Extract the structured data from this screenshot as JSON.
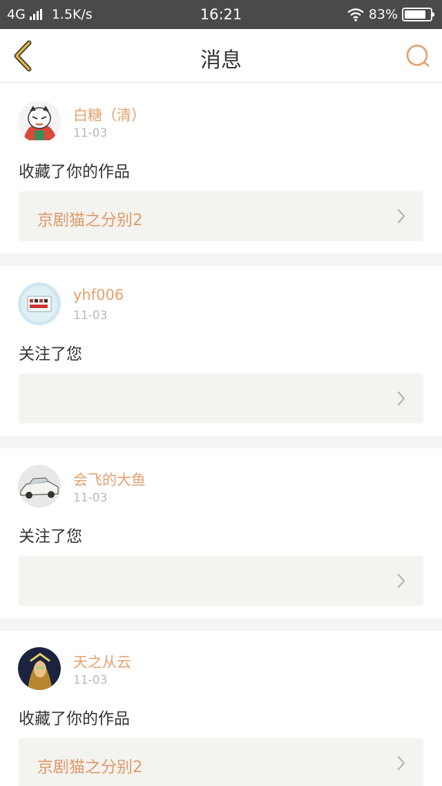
{
  "status_bar": {
    "network": "4G",
    "speed": "1.5K/s",
    "time": "16:21",
    "battery": "83%",
    "battery_level": 0.83
  },
  "nav": {
    "title": "消息",
    "back_icon": "chevron-left-icon",
    "search_icon": "search-icon"
  },
  "colors": {
    "accent": "#e6a06c",
    "back": "#e9b43a"
  },
  "messages": [
    {
      "user": "白糖（清）",
      "date": "11-03",
      "action": "收藏了你的作品",
      "work": "京剧猫之分别2"
    },
    {
      "user": "yhf006",
      "date": "11-03",
      "action": "关注了您",
      "work": ""
    },
    {
      "user": "会飞的大鱼",
      "date": "11-03",
      "action": "关注了您",
      "work": ""
    },
    {
      "user": "天之从云",
      "date": "11-03",
      "action": "收藏了你的作品",
      "work": "京剧猫之分别2"
    }
  ]
}
